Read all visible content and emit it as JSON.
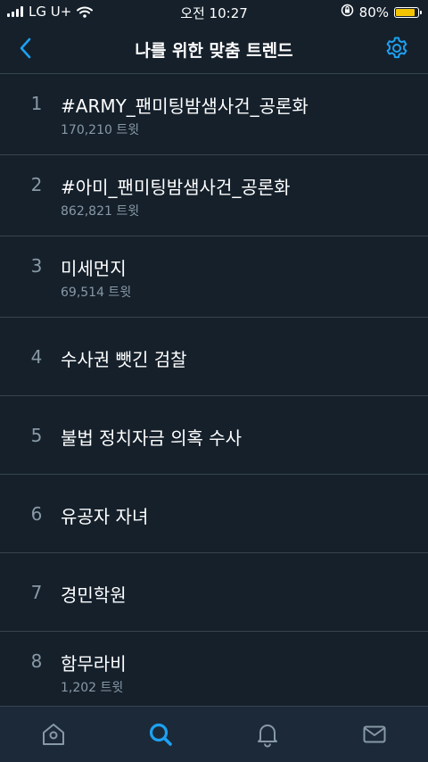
{
  "status_bar": {
    "carrier": "LG U+",
    "time": "오전 10:27",
    "battery_percent": "80%",
    "battery_level": 0.8
  },
  "header": {
    "title": "나를 위한 맞춤 트렌드",
    "back_icon": "chevron-left-icon",
    "settings_icon": "gear-icon"
  },
  "trends": [
    {
      "rank": "1",
      "name": "#ARMY_팬미팅밤샘사건_공론화",
      "count": "170,210 트윗"
    },
    {
      "rank": "2",
      "name": "#아미_팬미팅밤샘사건_공론화",
      "count": "862,821 트윗"
    },
    {
      "rank": "3",
      "name": "미세먼지",
      "count": "69,514 트윗"
    },
    {
      "rank": "4",
      "name": "수사권 뺏긴 검찰"
    },
    {
      "rank": "5",
      "name": "불법 정치자금 의혹 수사"
    },
    {
      "rank": "6",
      "name": "유공자 자녀"
    },
    {
      "rank": "7",
      "name": "경민학원"
    },
    {
      "rank": "8",
      "name": "함무라비",
      "count": "1,202 트윗"
    }
  ],
  "tab_bar": {
    "tabs": [
      "home-icon",
      "search-icon",
      "bell-icon",
      "mail-icon"
    ],
    "active": "search-icon"
  },
  "colors": {
    "background": "#15202b",
    "accent": "#1da1f2",
    "divider": "#38444d",
    "secondary_text": "#8899a6",
    "tab_bar": "#1c2938"
  }
}
